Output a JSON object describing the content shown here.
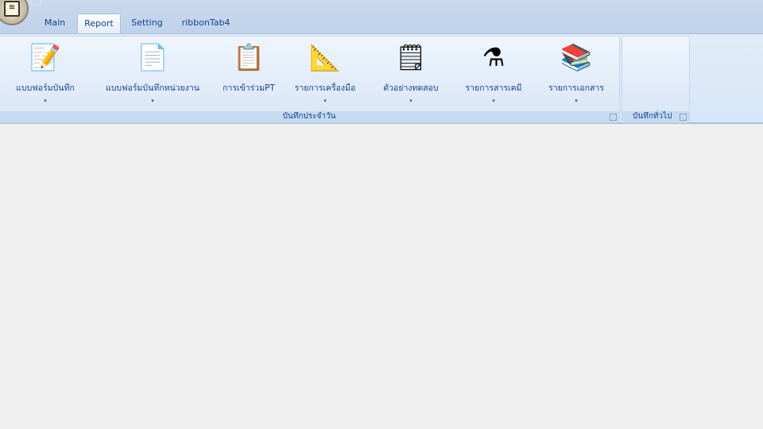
{
  "tabs": [
    {
      "label": "Main"
    },
    {
      "label": "Report"
    },
    {
      "label": "Setting"
    },
    {
      "label": "ribbonTab4"
    }
  ],
  "active_tab": "Report",
  "groups": [
    {
      "label": "บันทึกประจำวัน"
    },
    {
      "label": "บันทึกทั่วไป"
    }
  ],
  "buttons": [
    {
      "label": "แบบฟอร์มบันทึก",
      "icon": "form-pencil-icon",
      "dropdown": "▾"
    },
    {
      "label": "แบบฟอร์มบันทึกหน่วยงาน",
      "icon": "form-pen-icon",
      "dropdown": "▾"
    },
    {
      "label": "การเข้าร่วมPT",
      "icon": "clipboard-checklist-icon",
      "dropdown": ""
    },
    {
      "label": "รายการเครื่องมือ",
      "icon": "tools-ruler-icon",
      "dropdown": "▾"
    },
    {
      "label": "ตัวอย่างทดสอบ",
      "icon": "clipboard-sample-icon",
      "dropdown": "▾"
    },
    {
      "label": "รายการสารเคมี",
      "icon": "flask-icon",
      "dropdown": "▾"
    },
    {
      "label": "รายการเอกสาร",
      "icon": "books-folder-icon",
      "dropdown": "▾"
    }
  ]
}
